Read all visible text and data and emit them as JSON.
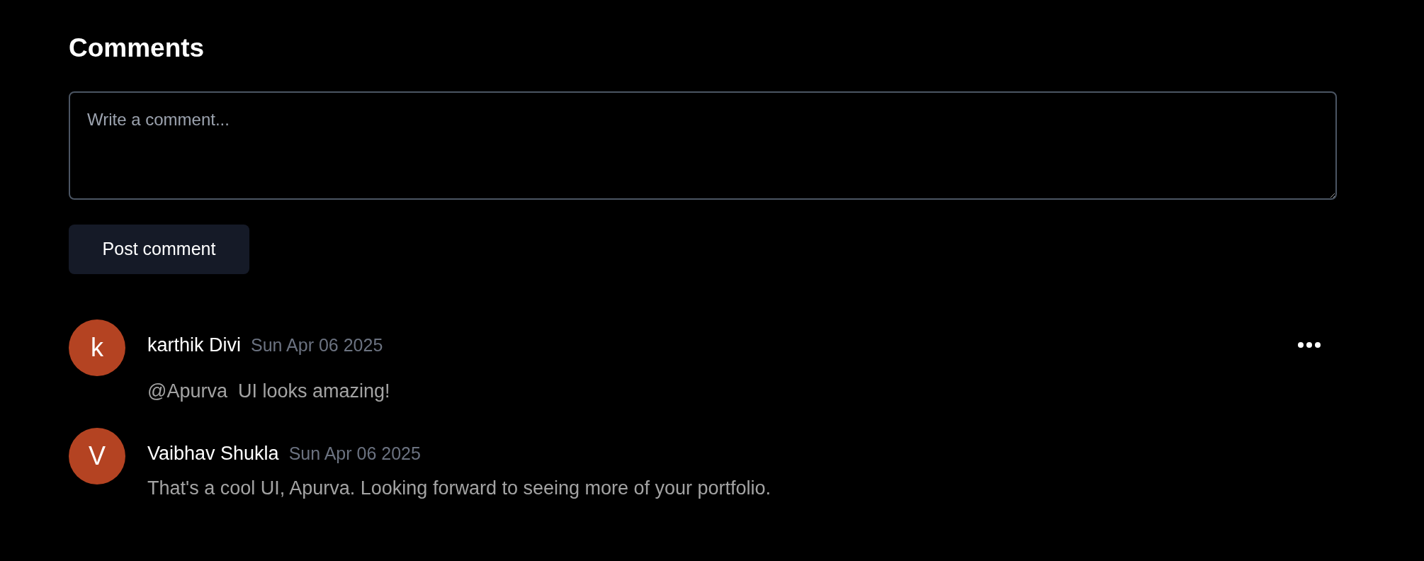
{
  "heading": "Comments",
  "composer": {
    "placeholder": "Write a comment...",
    "button": "Post comment"
  },
  "comments": [
    {
      "initial": "k",
      "color": "#b44322",
      "author": "karthik Divi",
      "date": "Sun Apr 06 2025",
      "text": "@Apurva  UI looks amazing!",
      "menu": true
    },
    {
      "initial": "V",
      "color": "#b44322",
      "author": "Vaibhav Shukla",
      "date": "Sun Apr 06 2025",
      "text": "That's a cool UI, Apurva. Looking forward to seeing more of your portfolio.",
      "menu": false
    }
  ]
}
